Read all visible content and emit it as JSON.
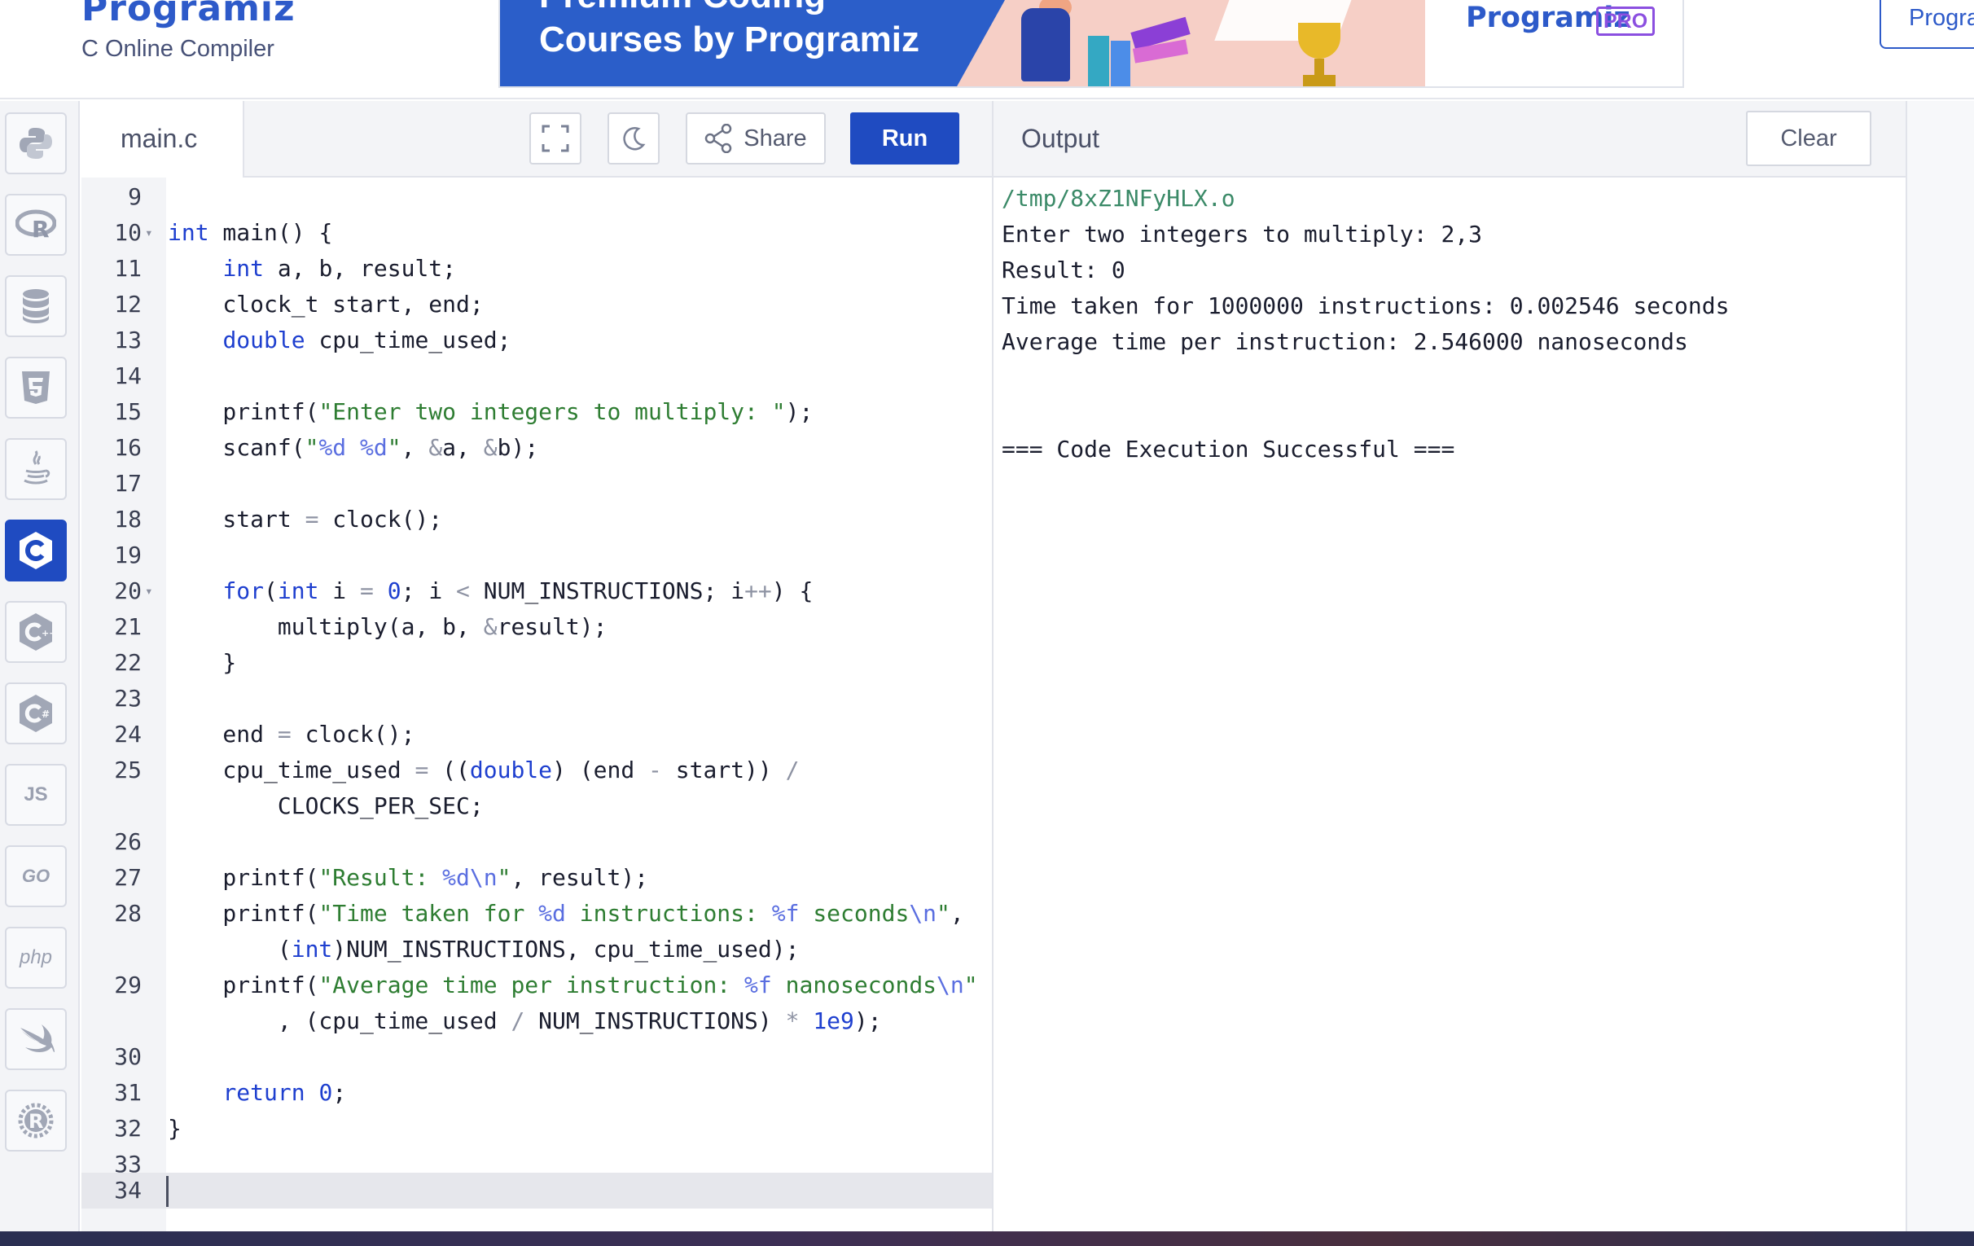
{
  "header": {
    "brand_name": "Programiz",
    "brand_subtitle": "C Online Compiler",
    "banner": {
      "title_line1": "Premium Coding",
      "title_line2": "Courses by Programiz",
      "pro_logo": "Programiz",
      "pro_badge": "PRO"
    },
    "cta_label": "Progra"
  },
  "sidebar": {
    "languages": [
      {
        "name": "python",
        "icon": "python-icon"
      },
      {
        "name": "r",
        "icon": "r-icon"
      },
      {
        "name": "sql",
        "icon": "database-icon"
      },
      {
        "name": "html",
        "icon": "html5-icon"
      },
      {
        "name": "java",
        "icon": "java-icon"
      },
      {
        "name": "c",
        "icon": "c-icon",
        "active": true
      },
      {
        "name": "cpp",
        "icon": "cpp-icon"
      },
      {
        "name": "csharp",
        "icon": "csharp-icon"
      },
      {
        "name": "js",
        "icon": "js-icon",
        "label": "JS"
      },
      {
        "name": "go",
        "icon": "go-icon",
        "label": "GO"
      },
      {
        "name": "php",
        "icon": "php-icon",
        "label": "php"
      },
      {
        "name": "swift",
        "icon": "swift-icon"
      },
      {
        "name": "rust",
        "icon": "rust-icon"
      }
    ],
    "active_color": "#1f4bc1"
  },
  "editor": {
    "file_name": "main.c",
    "share_label": "Share",
    "run_label": "Run",
    "lines": [
      {
        "no": "9",
        "text": ""
      },
      {
        "no": "10",
        "text": "int main() {"
      },
      {
        "no": "11",
        "text": "    int a, b, result;"
      },
      {
        "no": "12",
        "text": "    clock_t start, end;"
      },
      {
        "no": "13",
        "text": "    double cpu_time_used;"
      },
      {
        "no": "14",
        "text": ""
      },
      {
        "no": "15",
        "text": "    printf(\"Enter two integers to multiply: \");"
      },
      {
        "no": "16",
        "text": "    scanf(\"%d %d\", &a, &b);"
      },
      {
        "no": "17",
        "text": ""
      },
      {
        "no": "18",
        "text": "    start = clock();"
      },
      {
        "no": "19",
        "text": ""
      },
      {
        "no": "20",
        "text": "    for(int i = 0; i < NUM_INSTRUCTIONS; i++) {"
      },
      {
        "no": "21",
        "text": "        multiply(a, b, &result);"
      },
      {
        "no": "22",
        "text": "    }"
      },
      {
        "no": "23",
        "text": ""
      },
      {
        "no": "24",
        "text": "    end = clock();"
      },
      {
        "no": "25",
        "text": "    cpu_time_used = ((double) (end - start)) /"
      },
      {
        "no": "",
        "text": "        CLOCKS_PER_SEC;"
      },
      {
        "no": "26",
        "text": ""
      },
      {
        "no": "27",
        "text": "    printf(\"Result: %d\\n\", result);"
      },
      {
        "no": "28",
        "text": "    printf(\"Time taken for %d instructions: %f seconds\\n\","
      },
      {
        "no": "",
        "text": "        (int)NUM_INSTRUCTIONS, cpu_time_used);"
      },
      {
        "no": "29",
        "text": "    printf(\"Average time per instruction: %f nanoseconds\\n\""
      },
      {
        "no": "",
        "text": "        , (cpu_time_used / NUM_INSTRUCTIONS) * 1e9);"
      },
      {
        "no": "30",
        "text": ""
      },
      {
        "no": "31",
        "text": "    return 0;"
      },
      {
        "no": "32",
        "text": "}"
      },
      {
        "no": "33",
        "text": ""
      },
      {
        "no": "34",
        "text": ""
      }
    ]
  },
  "output": {
    "title": "Output",
    "clear_label": "Clear",
    "lines": [
      "/tmp/8xZ1NFyHLX.o",
      "Enter two integers to multiply: 2,3",
      "Result: 0",
      "Time taken for 1000000 instructions: 0.002546 seconds",
      "Average time per instruction: 2.546000 nanoseconds",
      "",
      "",
      "=== Code Execution Successful ==="
    ]
  }
}
